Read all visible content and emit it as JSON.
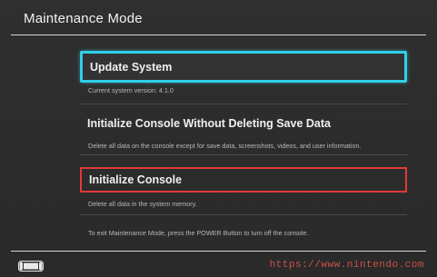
{
  "header": {
    "title": "Maintenance Mode"
  },
  "options": [
    {
      "label": "Update System",
      "description": "Current system version: 4.1.0",
      "state": "focused",
      "focus_color": "#2fd0e8"
    },
    {
      "label": "Initialize Console Without Deleting Save Data",
      "description": "Delete all data on the console except for save data, screenshots, videos, and user information."
    },
    {
      "label": "Initialize Console",
      "description": "Delete all data in the system memory.",
      "highlight_color": "#e23a3a"
    }
  ],
  "footer": {
    "instruction": "To exit Maintenance Mode, press the POWER Button to turn off the console.",
    "icon": "console-icon"
  },
  "watermark": {
    "text": "https://www.nintendo.com"
  }
}
